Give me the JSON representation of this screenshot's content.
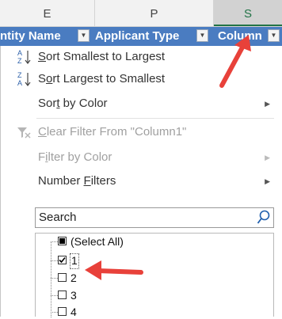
{
  "column_headers": [
    "E",
    "P",
    "S"
  ],
  "table_headers": {
    "entity_name": "ntity Name",
    "applicant_type": "Applicant Type",
    "column1": "Column"
  },
  "menu": {
    "sort_asc": {
      "pre": "",
      "u": "S",
      "post": "ort Smallest to Largest"
    },
    "sort_desc": {
      "pre": "S",
      "u": "o",
      "post": "rt Largest to Smallest"
    },
    "sort_color": {
      "pre": "Sor",
      "u": "t",
      "post": " by Color"
    },
    "clear_filter": {
      "pre": "",
      "u": "C",
      "post": "lear Filter From \"Column1\""
    },
    "filter_color": {
      "pre": "F",
      "u": "i",
      "post": "lter by Color"
    },
    "number_filters": {
      "pre": "Number ",
      "u": "F",
      "post": "ilters"
    }
  },
  "search": {
    "placeholder": "Search"
  },
  "values": [
    {
      "label": "(Select All)",
      "state": "partial"
    },
    {
      "label": "1",
      "state": "checked"
    },
    {
      "label": "2",
      "state": "unchecked"
    },
    {
      "label": "3",
      "state": "unchecked"
    },
    {
      "label": "4",
      "state": "unchecked"
    }
  ],
  "colors": {
    "table_header_bg": "#4a7cc1",
    "annotation_arrow": "#e8413a",
    "selected_column_text": "#217346"
  }
}
